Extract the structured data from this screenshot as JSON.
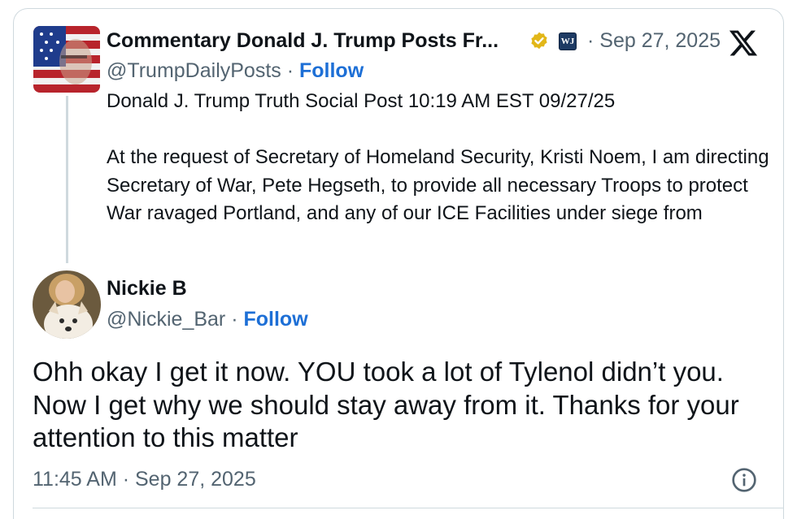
{
  "quoted_post": {
    "author_name": "Commentary Donald J. Trump Posts Fr...",
    "affiliate_badge_text": "WJ",
    "date": "· Sep 27, 2025",
    "handle": "@TrumpDailyPosts",
    "separator": " · ",
    "follow_label": "Follow",
    "text": "Donald J. Trump Truth Social Post 10:19 AM EST 09/27/25\n\nAt the request of Secretary of Homeland Security, Kristi Noem, I am directing Secretary of War, Pete Hegseth, to provide all necessary Troops to protect War ravaged Portland, and any of our ICE Facilities under siege from",
    "verified_color": "#e2b719"
  },
  "main_post": {
    "author_name": "Nickie B",
    "handle": "@Nickie_Bar",
    "separator": " · ",
    "follow_label": "Follow",
    "text": "Ohh okay I get it now.  YOU took a lot of Tylenol didn’t you.\nNow I get why we should stay away from it.  Thanks for your\nattention to this matter",
    "timestamp": "11:45 AM · Sep 27, 2025"
  },
  "icons": {
    "verified": "verified-badge-icon",
    "platform": "x-logo-icon",
    "info": "info-icon"
  },
  "colors": {
    "follow": "#1d6fd6",
    "secondary_text": "#536471",
    "primary_text": "#0f1419",
    "border": "#cfd9de"
  }
}
